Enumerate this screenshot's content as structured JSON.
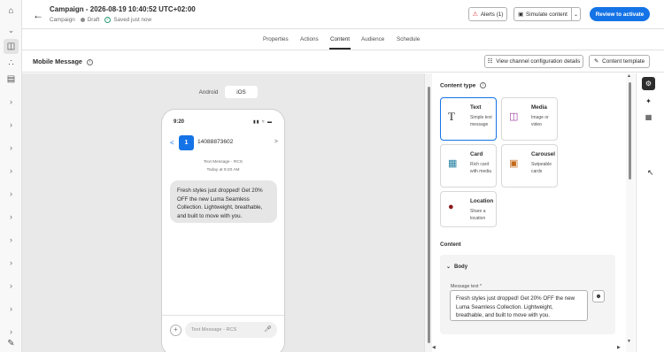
{
  "header": {
    "title": "Campaign - 2026-08-19 10:40:52 UTC+02:00",
    "type": "Campaign",
    "status": "Draft",
    "saved": "Saved just now",
    "alerts_label": "Alerts (1)",
    "simulate_label": "Simulate content",
    "review_label": "Review to activate"
  },
  "tabs": [
    "Properties",
    "Actions",
    "Content",
    "Audience",
    "Schedule"
  ],
  "active_tab": "Content",
  "section": {
    "title": "Mobile Message",
    "view_config_label": "View channel configuration details",
    "template_label": "Content template"
  },
  "preview": {
    "os_options": [
      "Android",
      "iOS"
    ],
    "selected_os": "iOS",
    "time": "9:20",
    "avatar_letter": "1",
    "sender": "14088873602",
    "meta_type": "Text Message - RCS",
    "meta_time": "Today at 9:20 AM",
    "message": "Fresh styles just dropped! Get 20% OFF the new Luma Seamless Collection. Lightweight, breathable, and built to move with you.",
    "input_placeholder": "Text Message - RCS"
  },
  "content_type": {
    "label": "Content type",
    "cards": [
      {
        "title": "Text",
        "desc": "Simple text message",
        "icon": "text-icon"
      },
      {
        "title": "Media",
        "desc": "Image or video",
        "icon": "image-icon"
      },
      {
        "title": "Card",
        "desc": "Rich card with media",
        "icon": "card-icon"
      },
      {
        "title": "Carousel",
        "desc": "Swipeable cards",
        "icon": "carousel-icon"
      },
      {
        "title": "Location",
        "desc": "Share a location",
        "icon": "location-pin-icon"
      }
    ],
    "selected": "Text"
  },
  "content": {
    "label": "Content",
    "body_label": "Body",
    "message_text_label": "Message text *",
    "message_text": "Fresh styles just dropped! Get 20% OFF the new Luma Seamless Collection. Lightweight, breathable, and built to move with you."
  },
  "colors": {
    "accent": "#1473e6",
    "alert": "#d7373f",
    "saved": "#2d9d78"
  }
}
